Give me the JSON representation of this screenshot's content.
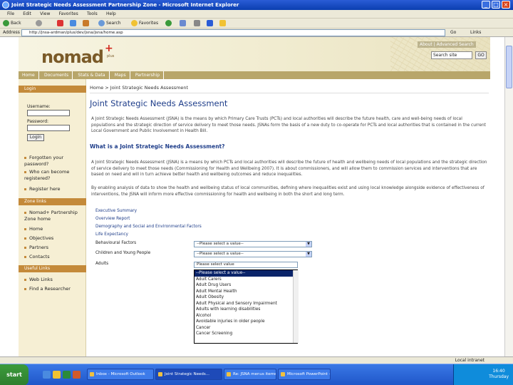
{
  "window": {
    "title": "Joint Strategic Needs Assessment Partnership Zone - Microsoft Internet Explorer"
  },
  "menu": [
    "File",
    "Edit",
    "View",
    "Favorites",
    "Tools",
    "Help"
  ],
  "toolbar": {
    "back": "Back",
    "search": "Search",
    "favorites": "Favorites"
  },
  "address": {
    "label": "Address",
    "url": "http://jnsa-ardman/plus/dev/jsna/jsna/home.asp",
    "go": "Go",
    "links": "Links"
  },
  "site": {
    "logo_text": "nomad",
    "logo_plus": "+",
    "logo_sub": "plus",
    "top_links": "About | Advanced Search",
    "search_placeholder": "Search site",
    "search_button": "GO",
    "nav": [
      "Home",
      "Documents",
      "Stats & Data",
      "Maps",
      "Partnership"
    ]
  },
  "sidebar": {
    "login_header": "Login",
    "username_label": "Username:",
    "password_label": "Password:",
    "login_button": "Login",
    "help_links": [
      "Forgotten your password?",
      "Who can become registered?",
      "Register here"
    ],
    "zone_header": "Zone links",
    "zone_links": [
      "Nomad+ Partnership Zone home",
      "Home",
      "Objectives",
      "Partners",
      "Contacts"
    ],
    "useful_header": "Useful Links",
    "useful_links": [
      "Web Links",
      "Find a Researcher"
    ]
  },
  "main": {
    "breadcrumb": "Home > Joint Strategic Needs Assessment",
    "title": "Joint Strategic Needs Assessment",
    "intro": "A Joint Strategic Needs Assessment (JSNA) is the means by which Primary Care Trusts (PCTs) and local authorities will describe the future health, care and well-being needs of local populations and the strategic direction of service delivery to meet those needs. JSNAs form the basis of a new duty to co-operate for PCTs and local authorities that is contained in the current Local Government and Public Involvement in Health Bill.",
    "subhead": "What is a Joint Strategic Needs Assessment?",
    "para1": "A Joint Strategic Needs Assessment (JSNA) is a means by which PCTs and local authorities will describe the future of health and wellbeing needs of local populations and the strategic direction of service delivery to meet those needs (Commissioning for Health and Wellbeing 2007). It is about commissioners, and will allow them to commission services and interventions that are based on need and will in turn achieve better health and wellbeing outcomes and reduce inequalities.",
    "para2": "By enabling analysis of data to show the health and wellbeing status of local communities, defining where inequalities exist and using local knowledge alongside evidence of effectiveness of interventions, the JSNA will inform more effective commissioning for health and wellbeing in both the short and long term.",
    "links": [
      "Executive Summary",
      "Overview Report",
      "Demography and Social and Environmental Factors",
      "Life Expectancy"
    ],
    "filters": [
      {
        "label": "Behavioural Factors",
        "value": "--Please select a value--"
      },
      {
        "label": "Children and Young People",
        "value": "--Please select a value--"
      },
      {
        "label": "Adults",
        "value": "Please select value"
      }
    ],
    "dropdown_options": [
      "--Please select a value--",
      "Adult Carers",
      "Adult Drug Users",
      "Adult Mental Health",
      "Adult Obesity",
      "Adult Physical and Sensory Impairment",
      "Adults with learning disabilities",
      "Alcohol",
      "Avoidable injuries in older people",
      "Cancer",
      "Cancer Screening"
    ]
  },
  "status": {
    "text": "Local intranet"
  },
  "taskbar": {
    "start": "start",
    "tasks": [
      "Inbox - Microsoft Outlook",
      "Joint Strategic Needs...",
      "Re: JSNA menus items...",
      "Microsoft PowerPoint - [..."
    ],
    "time": "16:40",
    "day": "Thursday"
  }
}
